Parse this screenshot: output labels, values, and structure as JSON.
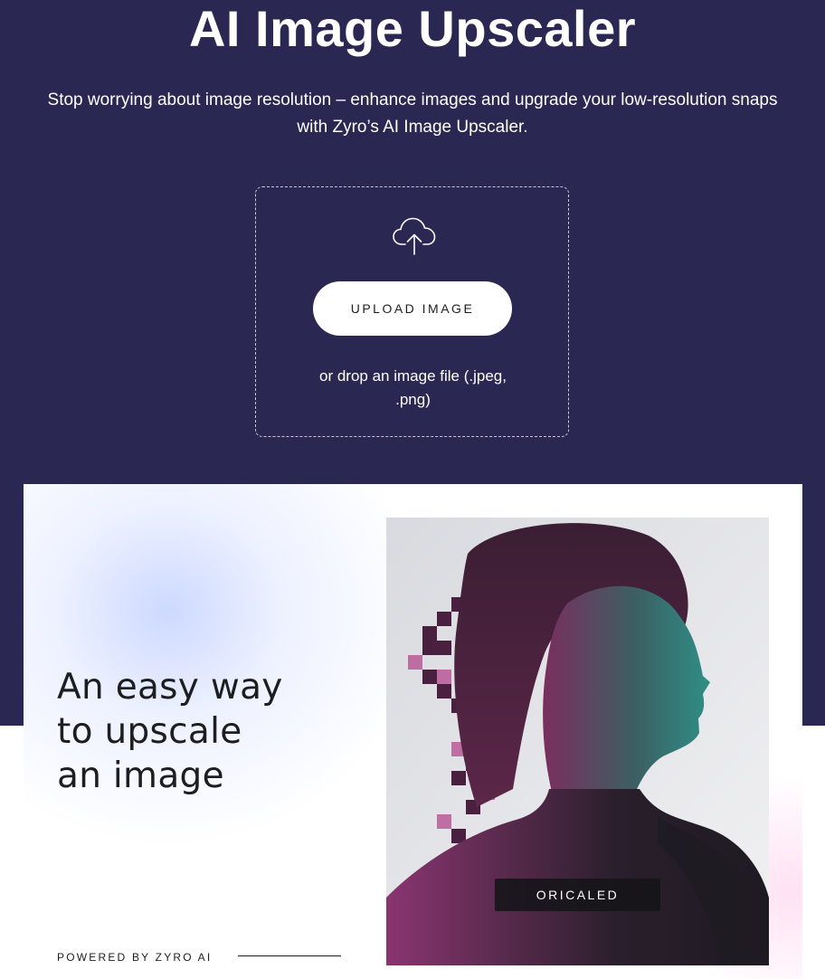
{
  "hero": {
    "title": "AI Image Upscaler",
    "subtitle_line1": "Stop worrying about image resolution – enhance images and upgrade your low-resolution snaps",
    "subtitle_line2": "with Zyro’s AI Image Upscaler.",
    "background_color": "#2a2752"
  },
  "upload": {
    "icon": "cloud-upload-icon",
    "button_label": "UPLOAD IMAGE",
    "hint_line1": "or drop an image file (.jpeg,",
    "hint_line2": ".png)"
  },
  "feature": {
    "headline_line1": "An easy way",
    "headline_line2": "to upscale",
    "headline_line3": "an image",
    "powered_by": "POWERED BY ZYRO AI",
    "image_label": "ORICALED"
  }
}
